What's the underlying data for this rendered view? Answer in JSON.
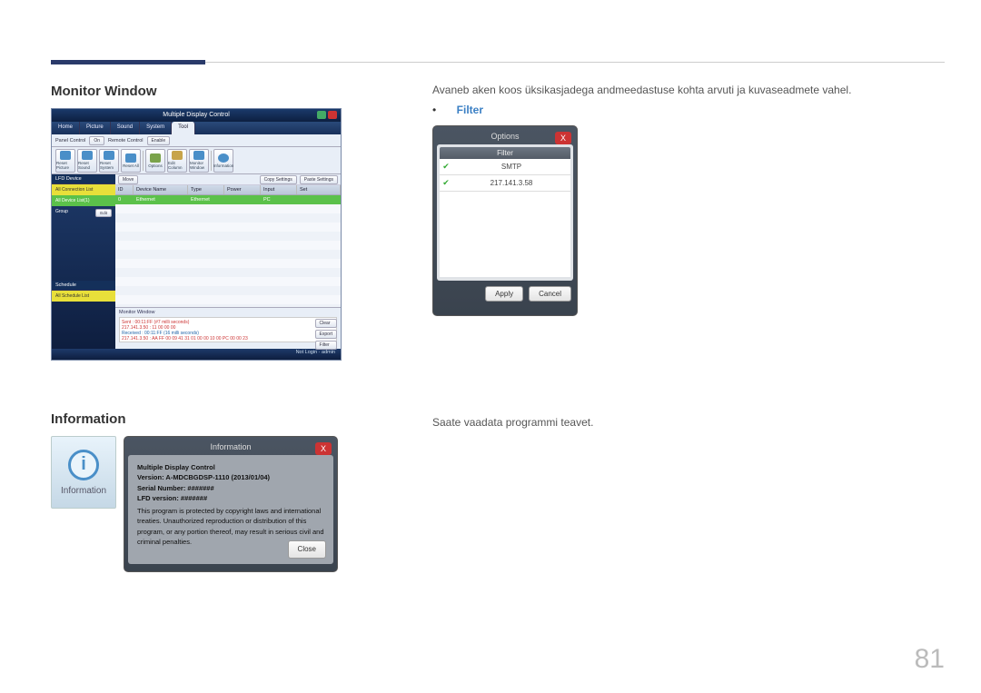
{
  "page_number": "81",
  "headings": {
    "monitor_window": "Monitor Window",
    "information": "Information"
  },
  "right": {
    "monitor_desc": "Avaneb aken koos üksikasjadega andmeedastuse kohta arvuti ja kuvaseadmete vahel.",
    "filter_label": "Filter",
    "info_desc": "Saate vaadata programmi teavet."
  },
  "mdc": {
    "title": "Multiple Display Control",
    "tabs": [
      "Home",
      "Picture",
      "Sound",
      "System",
      "Tool"
    ],
    "active_tab": 4,
    "subbar": {
      "panel_control_label": "Panel Control",
      "panel_control_value": "On",
      "remote_control_label": "Remote Control",
      "remote_control_value": "Enable"
    },
    "tools": [
      "Reset Picture",
      "Reset Sound",
      "Reset System",
      "Reset All",
      "Options",
      "Edit Column",
      "Monitor Window",
      "Information"
    ],
    "sidebar": {
      "lfd_header": "LFD Device",
      "items": [
        {
          "label": "All Connection List",
          "hl": true
        },
        {
          "label": "All Device List(1)",
          "sel": true
        },
        {
          "label": "Group",
          "edit": "Edit"
        }
      ],
      "schedule_header": "Schedule",
      "schedule_item": "All Schedule List"
    },
    "main_buttons": [
      "Move",
      "Copy Settings",
      "Paste Settings"
    ],
    "grid_headers": [
      "ID",
      "Device Name",
      "Type",
      "Power",
      "Input",
      "Set"
    ],
    "grid_row": {
      "id": "0",
      "name": "Ethernet",
      "type": "Ethernet",
      "power": "",
      "input": "PC",
      "set": ""
    },
    "monitor_title": "Monitor Window",
    "log_sent": "Sent : 00:11:FF (#7 milli seconds)",
    "log_addr": "217.141.3.50 : 11 00 00 00",
    "log_recv": "Received : 00:11:FF (16 milli seconds)",
    "log_recv2": "217.141.3.50 : AA FF 00 09 41 31 01 00 00 10 00 PC 00 00 23",
    "log_buttons": [
      "Clear",
      "Export",
      "Filter"
    ],
    "footer": "Not Login · admin"
  },
  "filter_dialog": {
    "title": "Options",
    "header": "Filter",
    "rows": [
      "SMTP",
      "217.141.3.58"
    ],
    "apply": "Apply",
    "cancel": "Cancel"
  },
  "info_tile": {
    "label": "Information"
  },
  "info_dialog": {
    "title": "Information",
    "app": "Multiple Display Control",
    "version": "Version: A-MDCBGDSP-1110 (2013/01/04)",
    "serial": "Serial Number: #######",
    "lfd": "LFD version: #######",
    "legal": "This program is protected by copyright laws and international treaties. Unauthorized reproduction or distribution of this program, or any portion thereof, may result in serious civil and criminal penalties.",
    "close": "Close"
  }
}
